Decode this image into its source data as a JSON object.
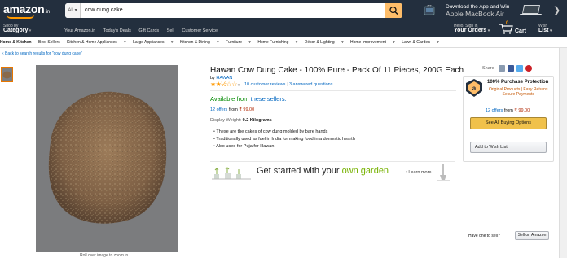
{
  "header": {
    "logo": "amazon",
    "logo_suffix": ".in",
    "search_category": "All",
    "search_value": "cow dung cake",
    "promo_line1": "Download the App and Win",
    "promo_line2": "Apple MacBook Air",
    "shop_by_small": "Shop by",
    "shop_by_big": "Category",
    "nav_links": [
      "Your Amazon.in",
      "Today's Deals",
      "Gift Cards",
      "Sell",
      "Customer Service"
    ],
    "account_small": "Hello. Sign in",
    "account_big": "Your Orders",
    "cart_label": "Cart",
    "cart_count": "0",
    "wish_small": "Wish",
    "wish_big": "List"
  },
  "category_bar": [
    "Home & Kitchen",
    "Best Sellers",
    "Kitchen & Home Appliances",
    "Large Appliances",
    "Kitchen & Dining",
    "Furniture",
    "Home Furnishing",
    "Décor & Lighting",
    "Home Improvement",
    "Lawn & Garden"
  ],
  "back_link": "‹ Back to search results for \"cow dung cake\"",
  "image_caption": "Roll over image to zoom in",
  "product": {
    "title": "Hawan Cow Dung Cake - 100% Pure - Pack Of 11 Pieces, 200G Each",
    "by_prefix": "by",
    "brand": "HAWAN",
    "rating": 2.5,
    "stars_display": "★★½☆☆",
    "reviews": "10 customer reviews",
    "questions": "3 answered questions",
    "availability_prefix": "Available from",
    "availability_link": "these sellers.",
    "offers_count": "12 offers",
    "offers_from": "from",
    "offers_price": "₹ 99.00",
    "weight_label": "Display Weight:",
    "weight_value": "0.2 Kilograms",
    "bullets": [
      "These are the cakes of cow dung molded by bare hands",
      "Traditionally used as fuel in India for making food in a domestic hearth",
      "Also used for Puja for Hawan"
    ]
  },
  "garden_banner": {
    "text_start": "Get started with your",
    "text_accent": "own garden",
    "learn_more": "› Learn more"
  },
  "buybox": {
    "share_label": "Share",
    "protection_title": "100% Purchase Protection",
    "protection_line1": "Original Products | Easy Returns",
    "protection_line2": "Secure Payments",
    "offers_count": "12 offers",
    "offers_from": "from",
    "offers_price": "₹ 99.00",
    "buy_button": "See All Buying Options",
    "wish_button": "Add to Wish List",
    "sell_prompt": "Have one to sell?",
    "sell_button": "Sell on Amazon"
  },
  "colors": {
    "header_bg": "#232f3e",
    "accent": "#febd69",
    "link": "#0066c0",
    "price": "#b12704",
    "available": "#008a00"
  }
}
